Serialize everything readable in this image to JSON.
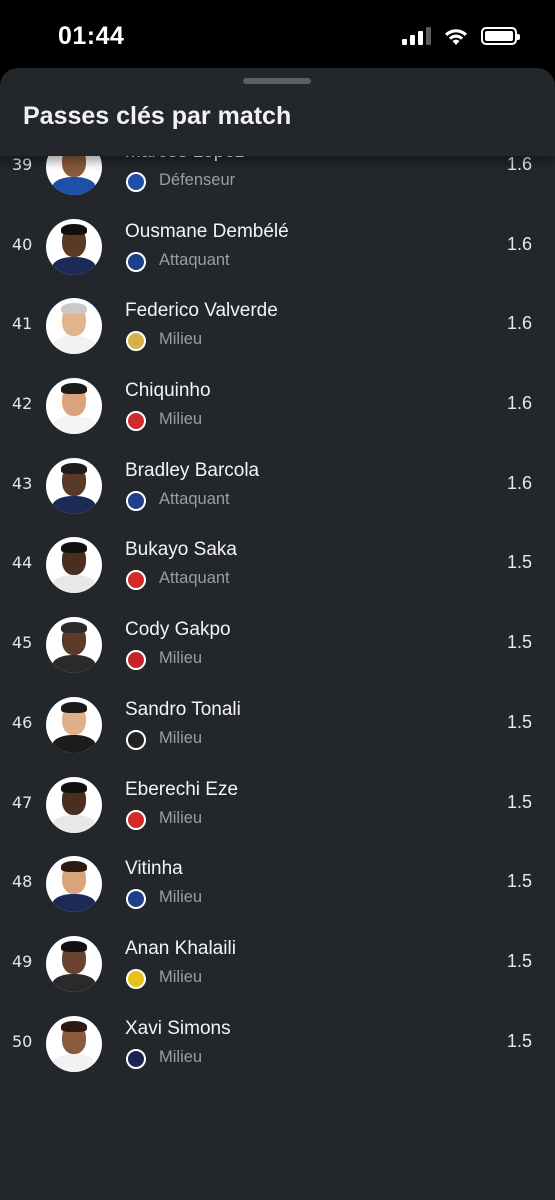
{
  "status_bar": {
    "time": "01:44"
  },
  "sheet": {
    "title": "Passes clés par match"
  },
  "colors": {
    "background": "#23262a",
    "text_primary": "#f4f4f4",
    "text_secondary": "#9a9da2"
  },
  "players": [
    {
      "rank": "39",
      "name": "Marcos López",
      "position": "Défenseur",
      "value": "1.6",
      "club_icon": "fc-copenhagen-crest-icon",
      "club_color": "#1f4fa8",
      "skin": "#8a5a3c",
      "hair": "#1a1a1a",
      "kit": "#1f4fa8"
    },
    {
      "rank": "40",
      "name": "Ousmane Dembélé",
      "position": "Attaquant",
      "value": "1.6",
      "club_icon": "psg-crest-icon",
      "club_color": "#1e3f8a",
      "skin": "#5a3a26",
      "hair": "#111111",
      "kit": "#1c2a55"
    },
    {
      "rank": "41",
      "name": "Federico Valverde",
      "position": "Milieu",
      "value": "1.6",
      "club_icon": "real-madrid-crest-icon",
      "club_color": "#d6b24a",
      "skin": "#e2b48e",
      "hair": "#c9c9c9",
      "kit": "#f2f2f2"
    },
    {
      "rank": "42",
      "name": "Chiquinho",
      "position": "Milieu",
      "value": "1.6",
      "club_icon": "olympiacos-crest-icon",
      "club_color": "#d02a2a",
      "skin": "#d9a47c",
      "hair": "#1a1a1a",
      "kit": "#f4f4f4"
    },
    {
      "rank": "43",
      "name": "Bradley Barcola",
      "position": "Attaquant",
      "value": "1.6",
      "club_icon": "psg-crest-icon",
      "club_color": "#1e3f8a",
      "skin": "#5a3a26",
      "hair": "#1c1c1c",
      "kit": "#1c2a55"
    },
    {
      "rank": "44",
      "name": "Bukayo Saka",
      "position": "Attaquant",
      "value": "1.5",
      "club_icon": "arsenal-crest-icon",
      "club_color": "#d22a2a",
      "skin": "#4a2e20",
      "hair": "#111111",
      "kit": "#e8e8e8"
    },
    {
      "rank": "45",
      "name": "Cody Gakpo",
      "position": "Milieu",
      "value": "1.5",
      "club_icon": "liverpool-crest-icon",
      "club_color": "#c8232c",
      "skin": "#5a3a28",
      "hair": "#2a2a2a",
      "kit": "#2a2a2a"
    },
    {
      "rank": "46",
      "name": "Sandro Tonali",
      "position": "Milieu",
      "value": "1.5",
      "club_icon": "newcastle-crest-icon",
      "club_color": "#222222",
      "skin": "#e0b08a",
      "hair": "#1a1a1a",
      "kit": "#1c1c1c"
    },
    {
      "rank": "47",
      "name": "Eberechi Eze",
      "position": "Milieu",
      "value": "1.5",
      "club_icon": "arsenal-crest-icon",
      "club_color": "#d22a2a",
      "skin": "#4a2e20",
      "hair": "#111111",
      "kit": "#e8e8e8"
    },
    {
      "rank": "48",
      "name": "Vitinha",
      "position": "Milieu",
      "value": "1.5",
      "club_icon": "psg-crest-icon",
      "club_color": "#1e3f8a",
      "skin": "#d9a47c",
      "hair": "#2a1a12",
      "kit": "#1c2a55"
    },
    {
      "rank": "49",
      "name": "Anan Khalaili",
      "position": "Milieu",
      "value": "1.5",
      "club_icon": "union-sg-crest-icon",
      "club_color": "#e8c21a",
      "skin": "#6a4430",
      "hair": "#111111",
      "kit": "#2a2a2a"
    },
    {
      "rank": "50",
      "name": "Xavi Simons",
      "position": "Milieu",
      "value": "1.5",
      "club_icon": "tottenham-crest-icon",
      "club_color": "#1b2450",
      "skin": "#8a5a3c",
      "hair": "#2a1a12",
      "kit": "#f2f2f2"
    }
  ]
}
